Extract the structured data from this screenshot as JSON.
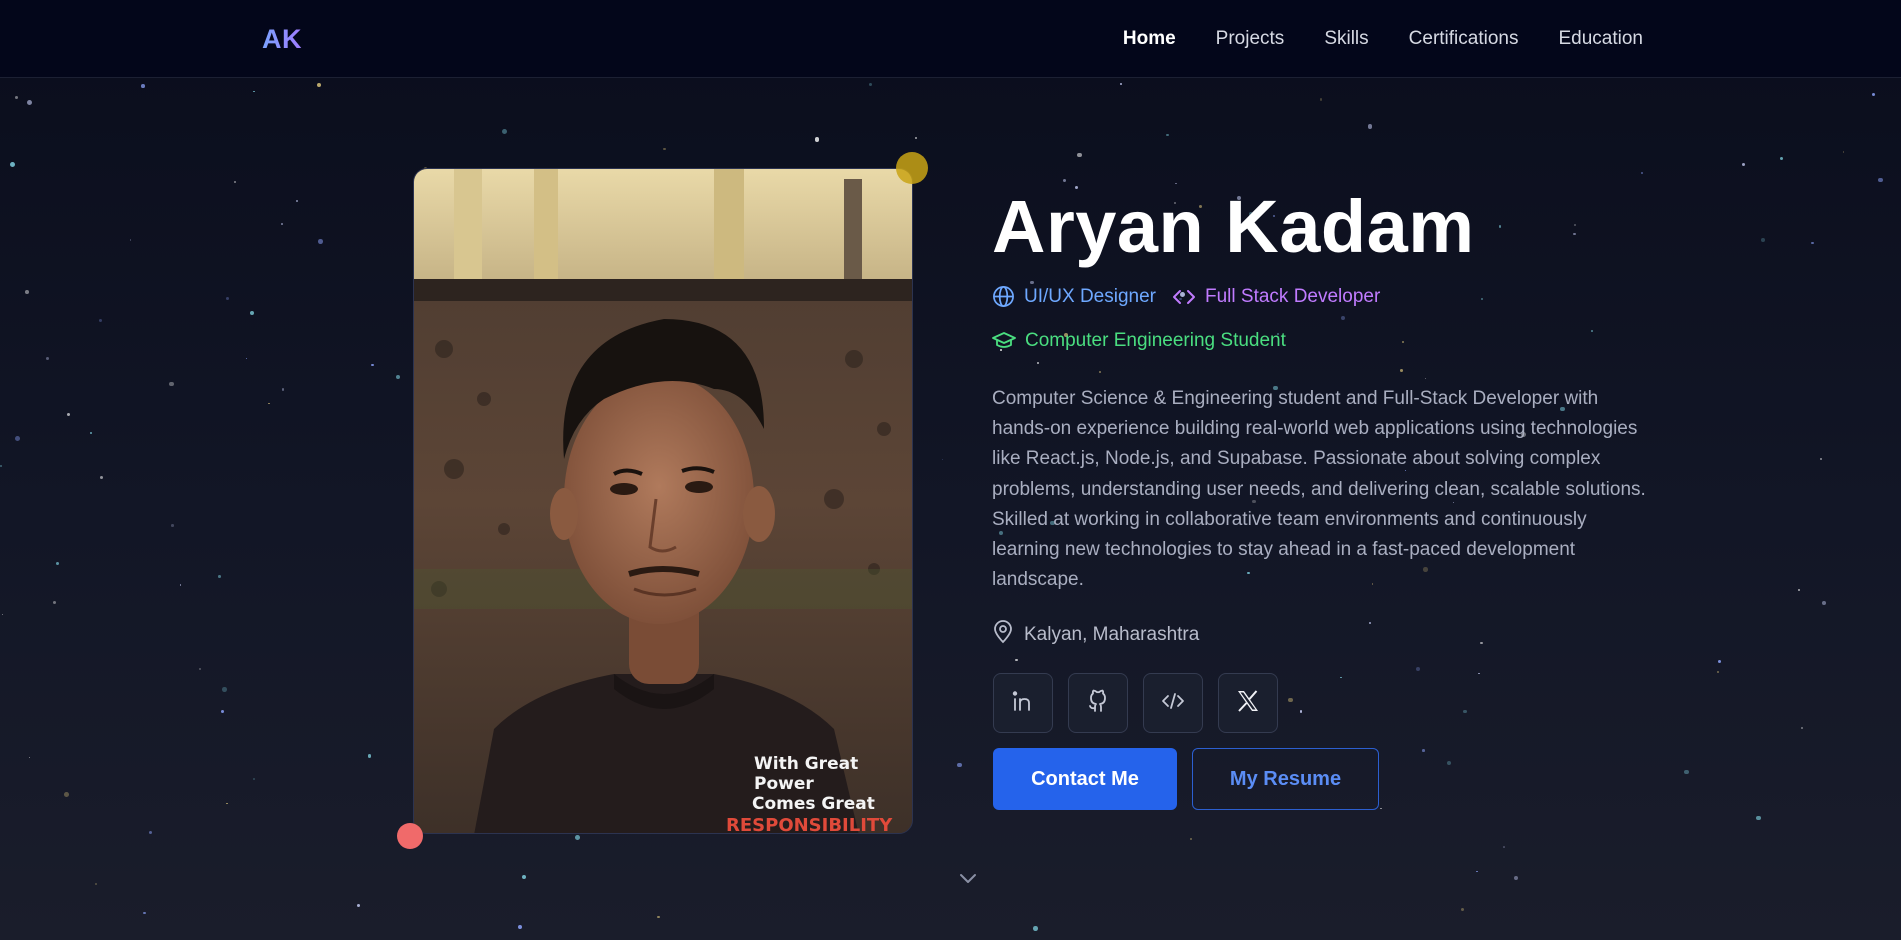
{
  "nav": {
    "logo": "AK",
    "links": [
      "Home",
      "Projects",
      "Skills",
      "Certifications",
      "Education"
    ],
    "active": "Home"
  },
  "hero": {
    "name": "Aryan Kadam",
    "roles": [
      {
        "label": "UI/UX Designer",
        "icon": "globe-icon",
        "color": "#6ea8ff"
      },
      {
        "label": "Full Stack Developer",
        "icon": "code-icon",
        "color": "#c07bff"
      },
      {
        "label": "Computer Engineering Student",
        "icon": "graduation-cap-icon",
        "color": "#4ade80"
      }
    ],
    "bio": "Computer Science & Engineering student and Full-Stack Developer with hands-on experience building real-world web applications using technologies like React.js, Node.js, and Supabase. Passionate about solving complex problems, understanding user needs, and delivering clean, scalable solutions. Skilled at working in collaborative team environments and continuously learning new technologies to stay ahead in a fast-paced development landscape.",
    "location": "Kalyan, Maharashtra",
    "photo_shirt_text": [
      "With Great",
      "Power",
      "Comes Great",
      "RESPONSIBILITY"
    ],
    "socials": [
      {
        "name": "linkedin-icon"
      },
      {
        "name": "github-icon"
      },
      {
        "name": "code-icon"
      },
      {
        "name": "x-icon"
      }
    ],
    "contact_label": "Contact Me",
    "resume_label": "My Resume"
  },
  "colors": {
    "accent": "#2563eb",
    "background": "#0a0d1c",
    "dot_yellow": "#c9a315",
    "dot_red": "#f06a6a"
  }
}
